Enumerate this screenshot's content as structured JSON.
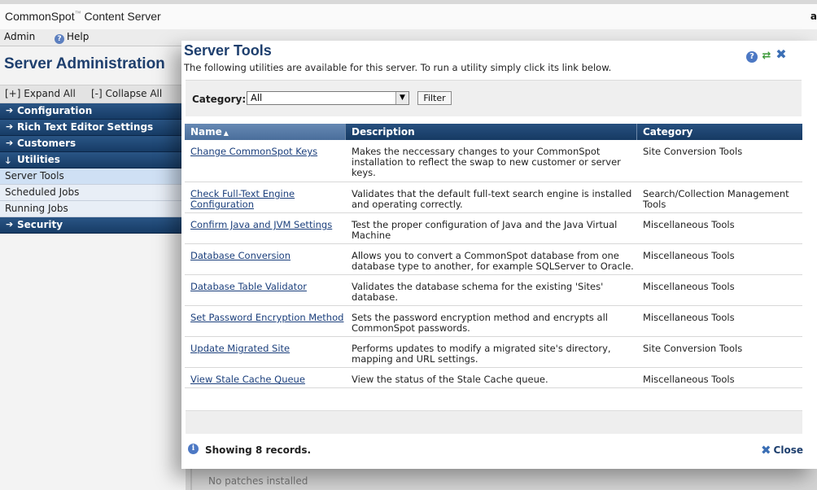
{
  "app": {
    "brand": "CommonSpot",
    "brand_mark": "™",
    "brand_suffix": "Content Server",
    "user_initial": "a"
  },
  "menu": {
    "admin": "Admin",
    "help": "Help"
  },
  "left": {
    "title": "Server Administration",
    "expand_all": "[+] Expand All",
    "collapse_all": "[-] Collapse All",
    "nav": [
      {
        "label": "Configuration",
        "arrow": "➔"
      },
      {
        "label": "Rich Text Editor Settings",
        "arrow": "➔"
      },
      {
        "label": "Customers",
        "arrow": "➔"
      },
      {
        "label": "Utilities",
        "arrow": "🡓"
      },
      {
        "label": "Server Tools"
      },
      {
        "label": "Scheduled Jobs"
      },
      {
        "label": "Running Jobs"
      },
      {
        "label": "Security",
        "arrow": "➔"
      }
    ],
    "patches": "No patches installed"
  },
  "modal": {
    "title": "Server Tools",
    "subtitle": "The following utilities are available for this server. To run a utility simply click its link below.",
    "category_label": "Category:",
    "category_value": "All",
    "filter_button": "Filter",
    "columns": {
      "name": "Name",
      "description": "Description",
      "category": "Category"
    },
    "rows": [
      {
        "name": "Change CommonSpot Keys",
        "description": "Makes the neccessary changes to your CommonSpot installation to reflect the swap to new customer or server keys.",
        "category": "Site Conversion Tools"
      },
      {
        "name": "Check Full-Text Engine Configuration",
        "description": "Validates that the default full-text search engine is installed and operating correctly.",
        "category": "Search/Collection Management Tools"
      },
      {
        "name": "Confirm Java and JVM Settings",
        "description": "Test the proper configuration of Java and the Java Virtual Machine",
        "category": "Miscellaneous Tools"
      },
      {
        "name": "Database Conversion",
        "description": "Allows you to convert a CommonSpot database from one database type to another, for example SQLServer to Oracle.",
        "category": "Miscellaneous Tools"
      },
      {
        "name": "Database Table Validator",
        "description": "Validates the database schema for the existing 'Sites' database.",
        "category": "Miscellaneous Tools"
      },
      {
        "name": "Set Password Encryption Method",
        "description": "Sets the password encryption method and encrypts all CommonSpot passwords.",
        "category": "Miscellaneous Tools"
      },
      {
        "name": "Update Migrated Site",
        "description": "Performs updates to modify a migrated site's directory, mapping and URL settings.",
        "category": "Site Conversion Tools"
      },
      {
        "name": "View Stale Cache Queue",
        "description": "View the status of the Stale Cache queue.",
        "category": "Miscellaneous Tools"
      }
    ],
    "showing": "Showing 8 records.",
    "close": "Close"
  }
}
